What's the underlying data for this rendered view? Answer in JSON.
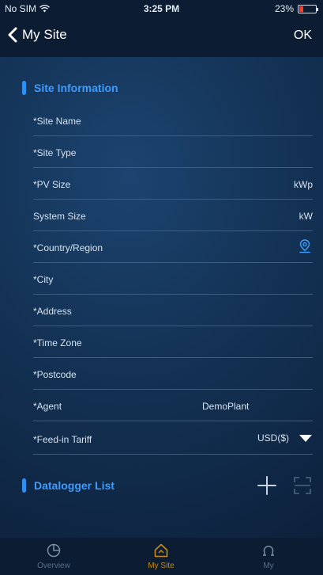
{
  "status": {
    "carrier": "No SIM",
    "time": "3:25 PM",
    "battery": "23%",
    "battery_level": 0.23
  },
  "nav": {
    "back_label": "My Site",
    "ok_label": "OK"
  },
  "site_info": {
    "title": "Site Information",
    "rows": [
      {
        "label": "*Site Name"
      },
      {
        "label": "*Site Type"
      },
      {
        "label": "*PV Size",
        "unit": "kWp"
      },
      {
        "label": "System Size",
        "unit": "kW"
      },
      {
        "label": "*Country/Region",
        "icon": "location-pin-icon"
      },
      {
        "label": "*City"
      },
      {
        "label": "*Address"
      },
      {
        "label": "*Time Zone"
      },
      {
        "label": "*Postcode"
      },
      {
        "label": "*Agent",
        "value": "DemoPlant"
      },
      {
        "label": "*Feed-in Tariff",
        "value": "USD($)",
        "icon": "triangle-down-icon"
      }
    ]
  },
  "datalogger": {
    "title": "Datalogger List",
    "icons": [
      "plus-icon",
      "scan-icon"
    ]
  },
  "tabs": [
    {
      "label": "Overview",
      "icon": "overview-icon",
      "active": false
    },
    {
      "label": "My Site",
      "icon": "home-icon",
      "active": true
    },
    {
      "label": "My",
      "icon": "user-icon",
      "active": false
    }
  ],
  "colors": {
    "accent_blue": "#3d9cff",
    "active_tab": "#c98a13",
    "background": "#143356"
  }
}
